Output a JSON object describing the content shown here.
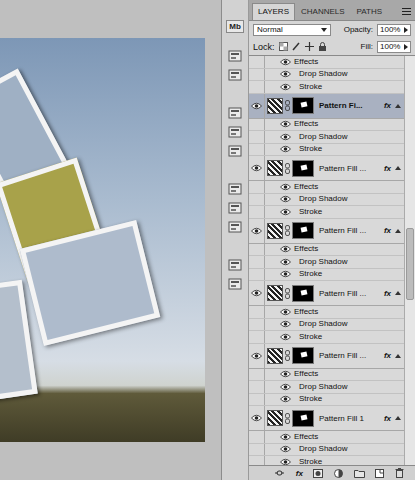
{
  "dock": {
    "label": "Mb"
  },
  "panel": {
    "tabs": [
      {
        "label": "LAYERS",
        "selected": true
      },
      {
        "label": "CHANNELS",
        "selected": false
      },
      {
        "label": "PATHS",
        "selected": false
      }
    ],
    "blend_mode": "Normal",
    "opacity_label": "Opacity:",
    "opacity": "100%",
    "lock_label": "Lock:",
    "fill_label": "Fill:",
    "fill": "100%"
  },
  "top_effects": {
    "visible": true,
    "label": "Effects",
    "effects": [
      {
        "name": "Drop Shadow",
        "visible": true
      },
      {
        "name": "Stroke",
        "visible": true
      }
    ]
  },
  "layers": [
    {
      "name": "Pattern Fi...",
      "selected": true,
      "visible": true,
      "fx": "fx",
      "effects_label": "Effects",
      "effects": [
        {
          "name": "Drop Shadow",
          "visible": true
        },
        {
          "name": "Stroke",
          "visible": true
        }
      ]
    },
    {
      "name": "Pattern Fill ...",
      "selected": false,
      "visible": true,
      "fx": "fx",
      "effects_label": "Effects",
      "effects": [
        {
          "name": "Drop Shadow",
          "visible": true
        },
        {
          "name": "Stroke",
          "visible": true
        }
      ]
    },
    {
      "name": "Pattern Fill ...",
      "selected": false,
      "visible": true,
      "fx": "fx",
      "effects_label": "Effects",
      "effects": [
        {
          "name": "Drop Shadow",
          "visible": true
        },
        {
          "name": "Stroke",
          "visible": true
        }
      ]
    },
    {
      "name": "Pattern Fill ...",
      "selected": false,
      "visible": true,
      "fx": "fx",
      "effects_label": "Effects",
      "effects": [
        {
          "name": "Drop Shadow",
          "visible": true
        },
        {
          "name": "Stroke",
          "visible": true
        }
      ]
    },
    {
      "name": "Pattern Fill ...",
      "selected": false,
      "visible": true,
      "fx": "fx",
      "effects_label": "Effects",
      "effects": [
        {
          "name": "Drop Shadow",
          "visible": true
        },
        {
          "name": "Stroke",
          "visible": true
        }
      ]
    },
    {
      "name": "Pattern Fill 1",
      "selected": false,
      "visible": true,
      "fx": "fx",
      "effects_label": "Effects",
      "effects": [
        {
          "name": "Drop Shadow",
          "visible": true
        },
        {
          "name": "Stroke",
          "visible": true
        }
      ]
    }
  ],
  "scrollbar": {
    "level": 0.42
  },
  "bottom_bar": {
    "fx_label": "fx"
  }
}
